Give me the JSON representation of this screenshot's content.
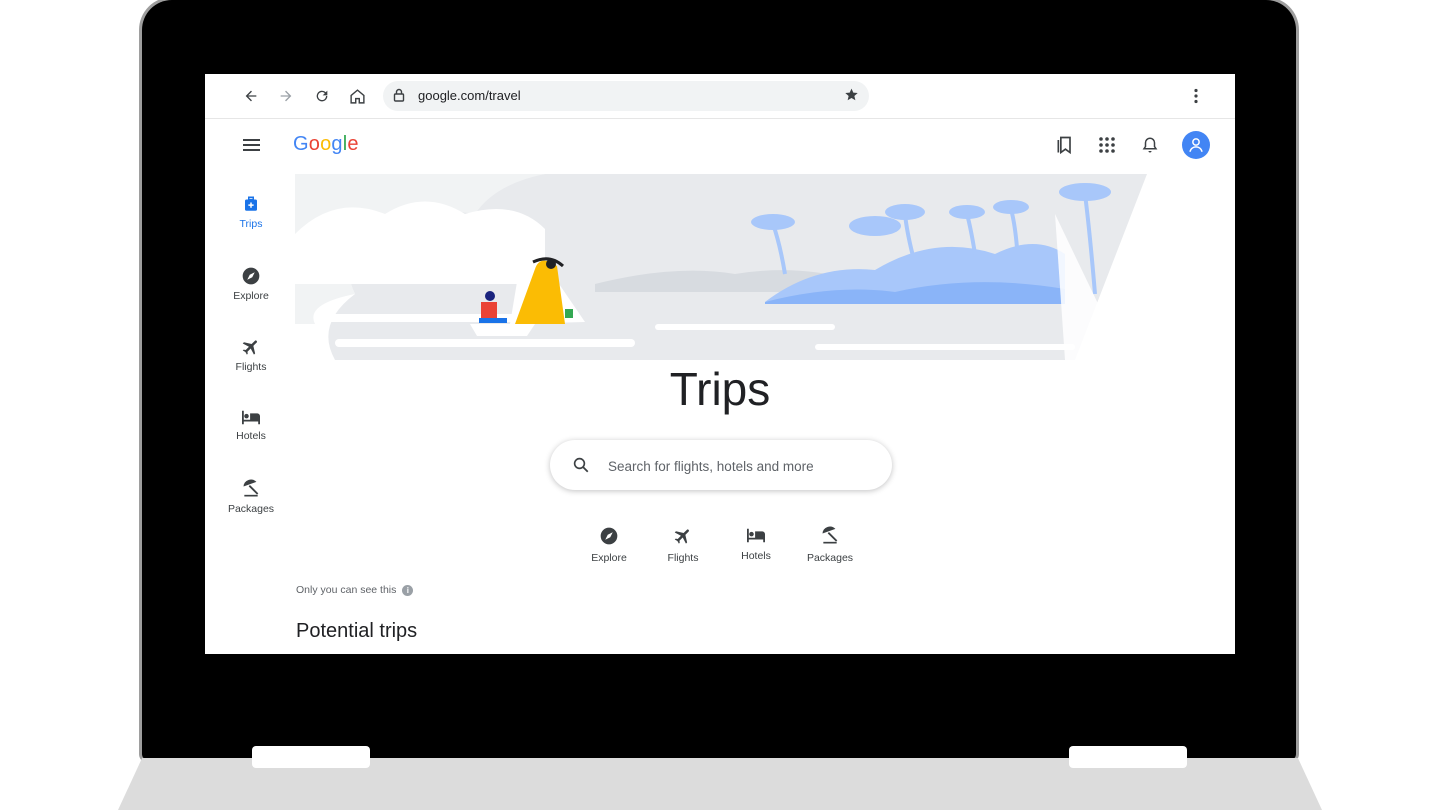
{
  "browser": {
    "url": "google.com/travel"
  },
  "header": {
    "logo_letters": [
      {
        "ch": "G",
        "color": "#4285F4"
      },
      {
        "ch": "o",
        "color": "#EA4335"
      },
      {
        "ch": "o",
        "color": "#FBBC05"
      },
      {
        "ch": "g",
        "color": "#4285F4"
      },
      {
        "ch": "l",
        "color": "#34A853"
      },
      {
        "ch": "e",
        "color": "#EA4335"
      }
    ],
    "icons": [
      "saved-icon",
      "apps-grid-icon",
      "notifications-bell-icon",
      "account-avatar-icon"
    ]
  },
  "rail": {
    "items": [
      {
        "label": "Trips",
        "icon": "suitcase-icon",
        "active": true
      },
      {
        "label": "Explore",
        "icon": "compass-icon"
      },
      {
        "label": "Flights",
        "icon": "airplane-icon"
      },
      {
        "label": "Hotels",
        "icon": "bed-icon"
      },
      {
        "label": "Packages",
        "icon": "beach-umbrella-icon"
      }
    ]
  },
  "main": {
    "title": "Trips",
    "search": {
      "placeholder": "Search for flights, hotels and more"
    },
    "chips": [
      {
        "label": "Explore",
        "icon": "compass-icon"
      },
      {
        "label": "Flights",
        "icon": "airplane-icon"
      },
      {
        "label": "Hotels",
        "icon": "bed-icon"
      },
      {
        "label": "Packages",
        "icon": "beach-umbrella-icon"
      }
    ],
    "privacy_note": "Only you can see this",
    "section_title": "Potential trips"
  },
  "colors": {
    "accent": "#1a73e8",
    "text": "#202124",
    "muted": "#5f6368",
    "hero_sky": "#e8eaed",
    "hero_palms": "#a8c7fa"
  }
}
